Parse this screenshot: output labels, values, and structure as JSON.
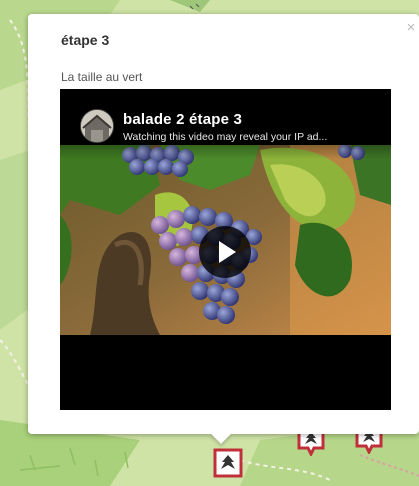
{
  "popup": {
    "title": "étape 3",
    "subtitle": "La taille au vert",
    "close_label": "×"
  },
  "video": {
    "title": "balade 2 étape 3",
    "warning": "Watching this video may reveal your IP ad...",
    "play_icon": "play-icon",
    "thumbnail": "grape-vine-photo"
  },
  "map": {
    "marker_icon": "vine-leaf-icon",
    "marker_color": "#c0303a"
  }
}
